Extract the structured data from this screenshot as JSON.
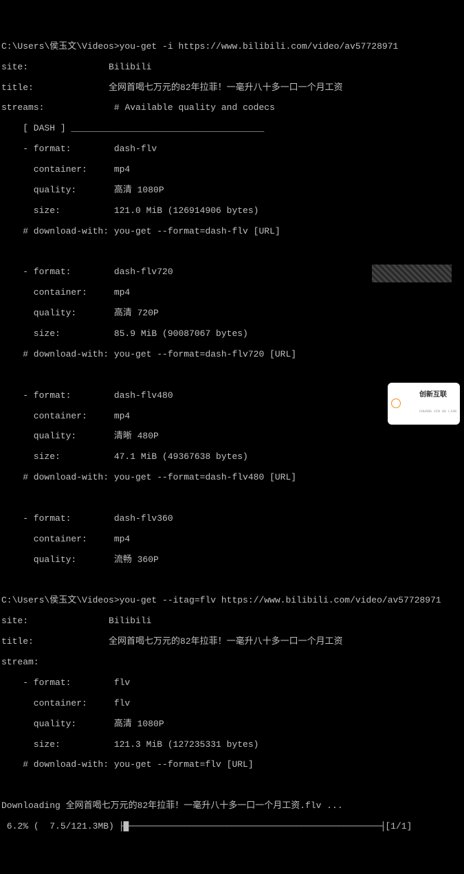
{
  "cmd1_prompt": "C:\\Users\\侯玉文\\Videos>",
  "cmd1": "you-get -i https://www.bilibili.com/video/av57728971",
  "site_label": "site:",
  "site_value": "Bilibili",
  "title_label": "title:",
  "title_value": "全网首喝七万元的82年拉菲！一毫升八十多一口一个月工资",
  "streams_label": "streams:",
  "streams_comment": "# Available quality and codecs",
  "dash_header": "    [ DASH ] ____________________________________",
  "fmt": [
    {
      "format": "dash-flv",
      "container": "mp4",
      "quality": "高清 1080P",
      "size": "121.0 MiB (126914906 bytes)",
      "dl": "you-get --format=dash-flv [URL]"
    },
    {
      "format": "dash-flv720",
      "container": "mp4",
      "quality": "高清 720P",
      "size": "85.9 MiB (90087067 bytes)",
      "dl": "you-get --format=dash-flv720 [URL]"
    },
    {
      "format": "dash-flv480",
      "container": "mp4",
      "quality": "清晰 480P",
      "size": "47.1 MiB (49367638 bytes)",
      "dl": "you-get --format=dash-flv480 [URL]"
    },
    {
      "format": "dash-flv360",
      "container": "mp4",
      "quality": "流畅 360P"
    }
  ],
  "cmd2_prompt": "C:\\Users\\侯玉文\\Videos>",
  "cmd2": "you-get --itag=flv https://www.bilibili.com/video/av57728971",
  "site2_value": "Bilibili",
  "title2_value": "全网首喝七万元的82年拉菲！一毫升八十多一口一个月工资",
  "stream2_label": "stream:",
  "fmt2": {
    "format": "flv",
    "container": "flv",
    "quality": "高清 1080P",
    "size": "121.3 MiB (127235331 bytes)",
    "dl": "you-get --format=flv [URL]"
  },
  "downloading_label": "Downloading",
  "downloading_file": "全网首喝七万元的82年拉菲！一毫升八十多一口一个月工资.flv ...",
  "progress_pct": " 6.2%",
  "progress_size": "(  7.5/121.3MB)",
  "progress_bar": " ├█──────────────────────────────────────────────────────┤",
  "progress_parts": "[1/1]",
  "watermark": "创新互联",
  "watermark_sub": "CHUANG XIN HU LIAN"
}
